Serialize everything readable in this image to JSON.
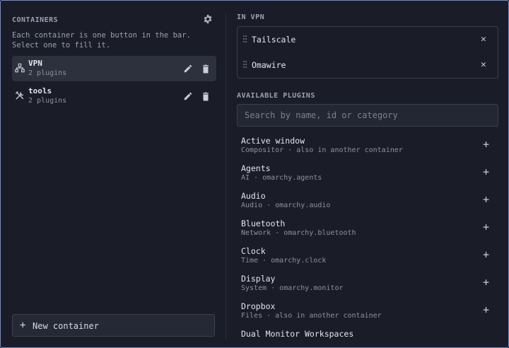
{
  "containers_title": "CONTAINERS",
  "description": "Each container is one button in the bar. Select one to fill it.",
  "containers": [
    {
      "name": "VPN",
      "sub": "2 plugins",
      "icon": "network-icon"
    },
    {
      "name": "tools",
      "sub": "2 plugins",
      "icon": "tools-icon"
    }
  ],
  "new_container": "New container",
  "in_vpn_title": "IN VPN",
  "in_vpn": [
    {
      "name": "Tailscale"
    },
    {
      "name": "Omawire"
    }
  ],
  "available_title": "AVAILABLE PLUGINS",
  "search": {
    "placeholder": "Search by name, id or category"
  },
  "plugins": [
    {
      "name": "Active window",
      "sub": "Compositor · also in another container"
    },
    {
      "name": "Agents",
      "sub": "AI · omarchy.agents"
    },
    {
      "name": "Audio",
      "sub": "Audio · omarchy.audio"
    },
    {
      "name": "Bluetooth",
      "sub": "Network · omarchy.bluetooth"
    },
    {
      "name": "Clock",
      "sub": "Time · omarchy.clock"
    },
    {
      "name": "Display",
      "sub": "System · omarchy.monitor"
    },
    {
      "name": "Dropbox",
      "sub": "Files · also in another container"
    },
    {
      "name": "Dual Monitor Workspaces",
      "sub": ""
    }
  ],
  "icons": {
    "add": "+",
    "remove": "✕",
    "new": "+"
  },
  "colors": {
    "accent_border": "#6b8fd6",
    "background": "#1a1d27",
    "selected": "#2d313e"
  }
}
